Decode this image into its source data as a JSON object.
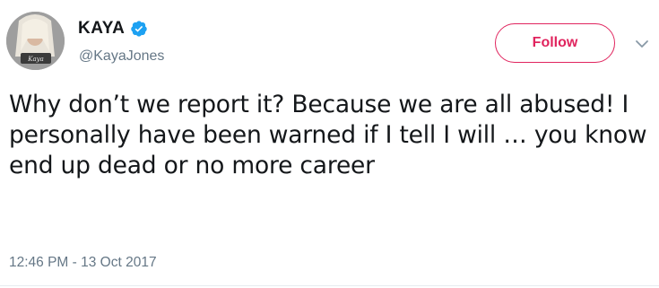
{
  "tweet": {
    "display_name": "KAYA",
    "handle": "@KayaJones",
    "follow_label": "Follow",
    "text": "Why don’t we report it? Because we are all abused! I personally have been warned if I tell I will … you know end up dead or no more career",
    "timestamp": "12:46 PM - 13 Oct 2017",
    "avatar_caption": "Kaya"
  },
  "icons": {
    "verified": "verified-badge-icon",
    "caret": "chevron-down-icon"
  },
  "colors": {
    "follow_accent": "#e0245e",
    "verified_blue": "#1da1f2",
    "muted_text": "#657786",
    "primary_text": "#14171a"
  }
}
